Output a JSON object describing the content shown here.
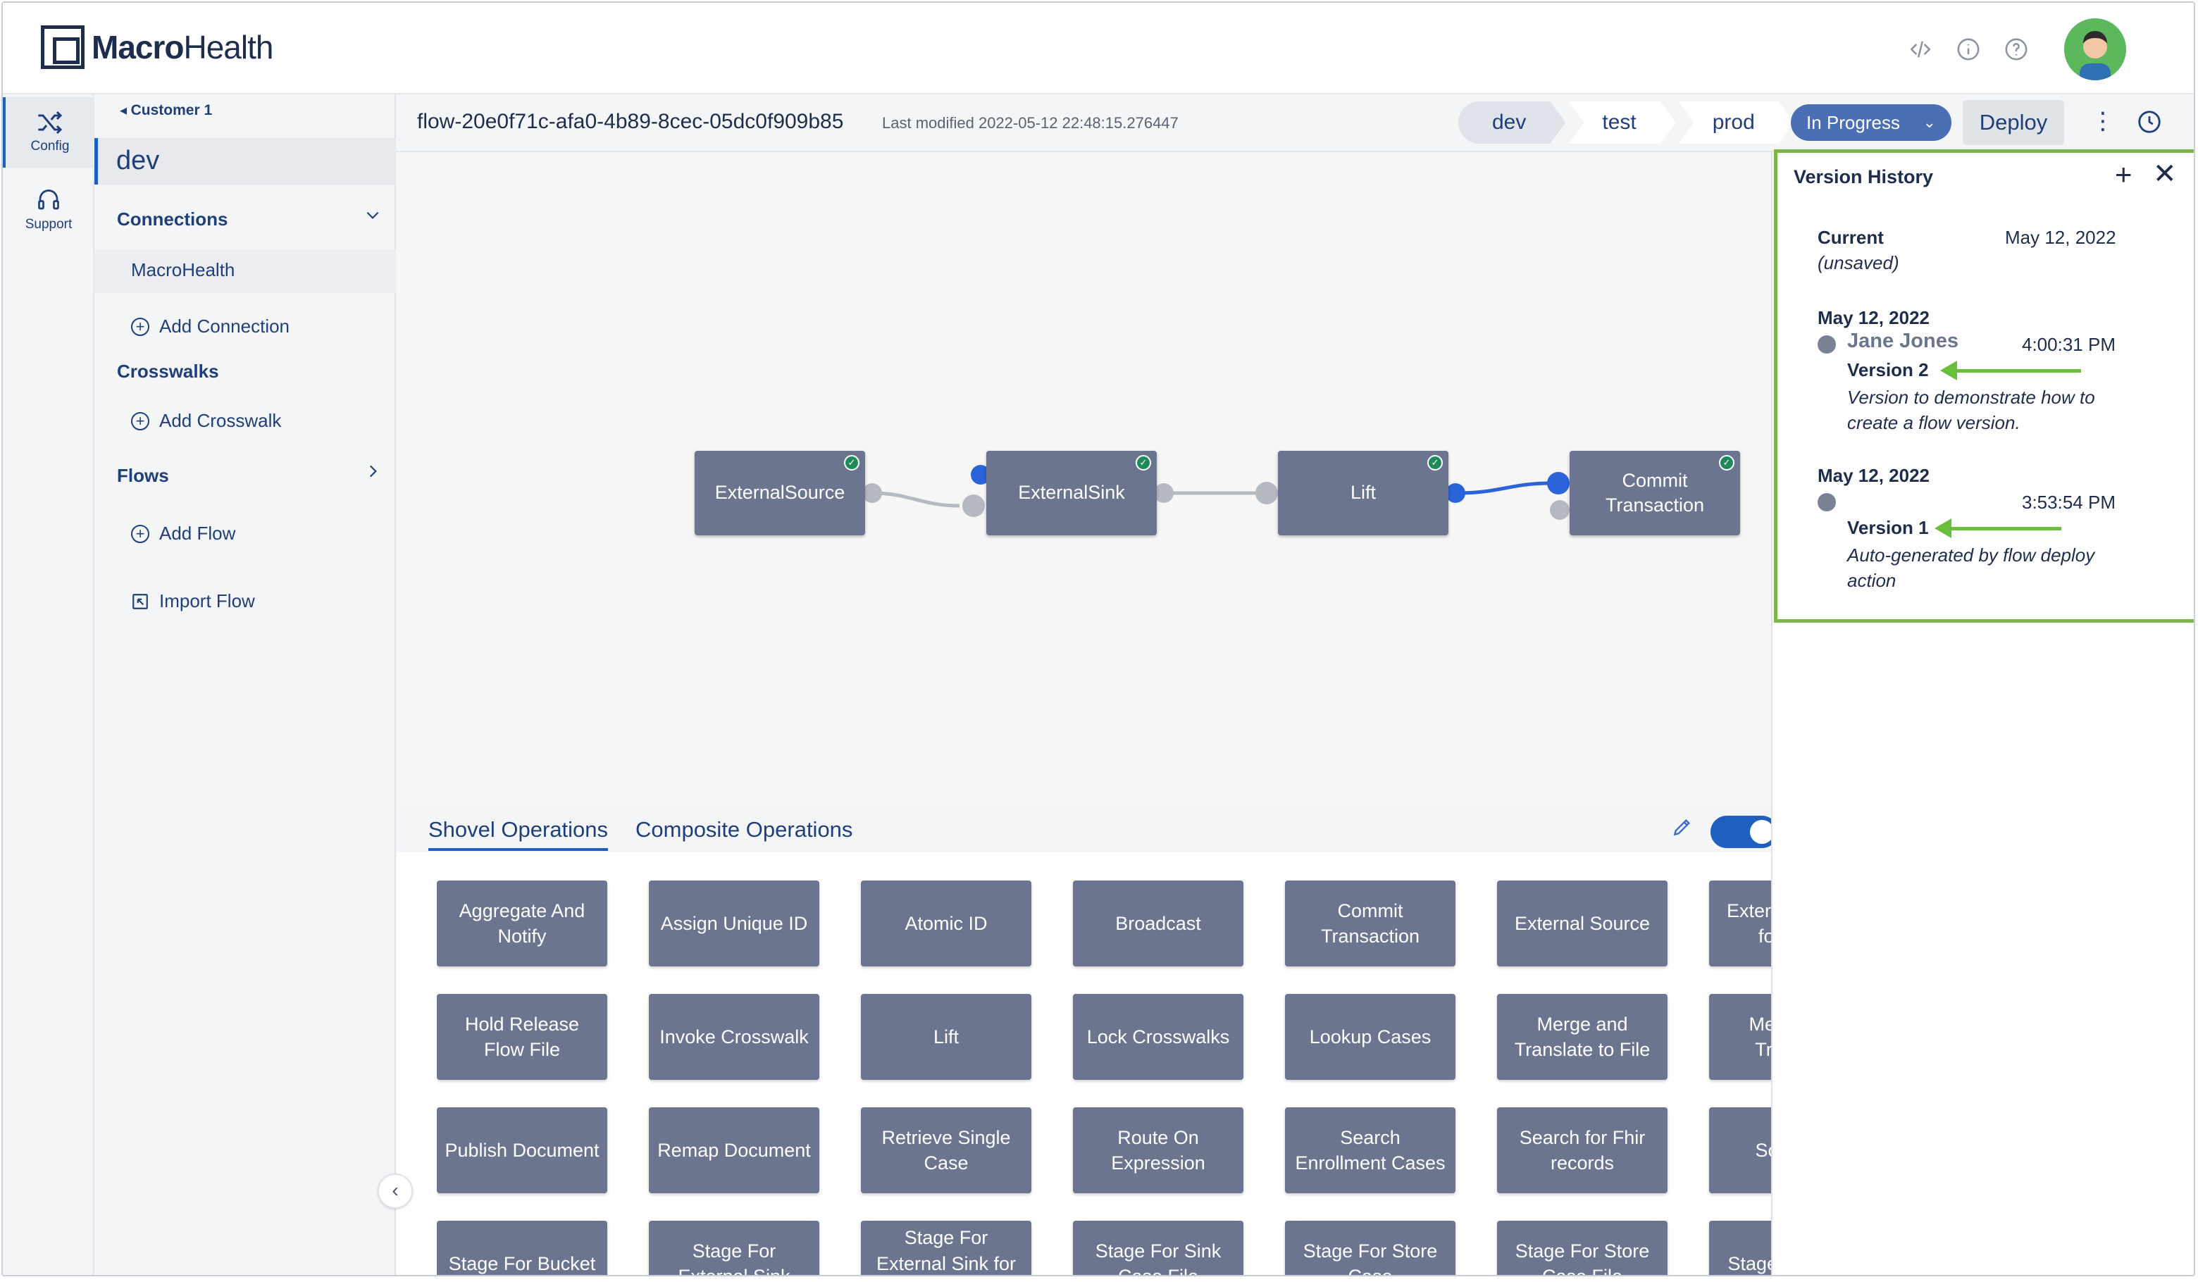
{
  "header": {
    "logo_bold": "Macro",
    "logo_rest": "Health",
    "icons": [
      "code-icon",
      "info-icon",
      "help-icon"
    ]
  },
  "rail": {
    "items": [
      {
        "label": "Config",
        "icon": "shuffle-icon",
        "active": true
      },
      {
        "label": "Support",
        "icon": "headset-icon",
        "active": false
      }
    ]
  },
  "sidebar": {
    "breadcrumb": "Customer 1",
    "environment": "dev",
    "connections_title": "Connections",
    "connections": [
      "MacroHealth"
    ],
    "add_connection": "Add Connection",
    "crosswalks_title": "Crosswalks",
    "add_crosswalk": "Add Crosswalk",
    "flows_title": "Flows",
    "add_flow": "Add Flow",
    "import_flow": "Import Flow"
  },
  "toolbar": {
    "flow_id": "flow-20e0f71c-afa0-4b89-8cec-05dc0f909b85",
    "last_modified": "Last modified 2022-05-12 22:48:15.276447",
    "envs": [
      "dev",
      "test",
      "prod"
    ],
    "status": "In Progress",
    "deploy": "Deploy"
  },
  "canvas": {
    "nodes": [
      "ExternalSource",
      "ExternalSink",
      "Lift",
      "Commit Transaction"
    ]
  },
  "operations": {
    "tabs": [
      "Shovel Operations",
      "Composite Operations"
    ],
    "toggle_on": true,
    "items": [
      "Aggregate And Notify",
      "Assign Unique ID",
      "Atomic ID",
      "Broadcast",
      "Commit Transaction",
      "External Source",
      "External Source for FHIR",
      "Hold Release Flow File",
      "Invoke Crosswalk",
      "Lift",
      "Lock Crosswalks",
      "Lookup Cases",
      "Merge and Translate to File",
      "Merge and Translate",
      "Publish Document",
      "Remap Document",
      "Retrieve Single Case",
      "Route On Expression",
      "Search Enrollment Cases",
      "Search for Fhir records",
      "Source B",
      "Stage For Bucket",
      "Stage For External Sink",
      "Stage For External Sink for FHIR",
      "Stage For Sink Case File",
      "Stage For Store Case",
      "Stage For Store Case File",
      "Stage For Case"
    ]
  },
  "version_history": {
    "title": "Version History",
    "current_label": "Current",
    "current_note": "(unsaved)",
    "current_date": "May 12, 2022",
    "versions": [
      {
        "date": "May 12, 2022",
        "user": "Jane Jones",
        "time": "4:00:31 PM",
        "name": "Version 2",
        "description": "Version to demonstrate how to create a flow version."
      },
      {
        "date": "May 12, 2022",
        "user": "",
        "time": "3:53:54 PM",
        "name": "Version 1",
        "description": "Auto-generated by flow deploy action"
      }
    ],
    "highlight_color": "#7ab648"
  },
  "colors": {
    "accent": "#1f5fbf",
    "node": "#6b7590",
    "status": "#4a6fb5"
  }
}
